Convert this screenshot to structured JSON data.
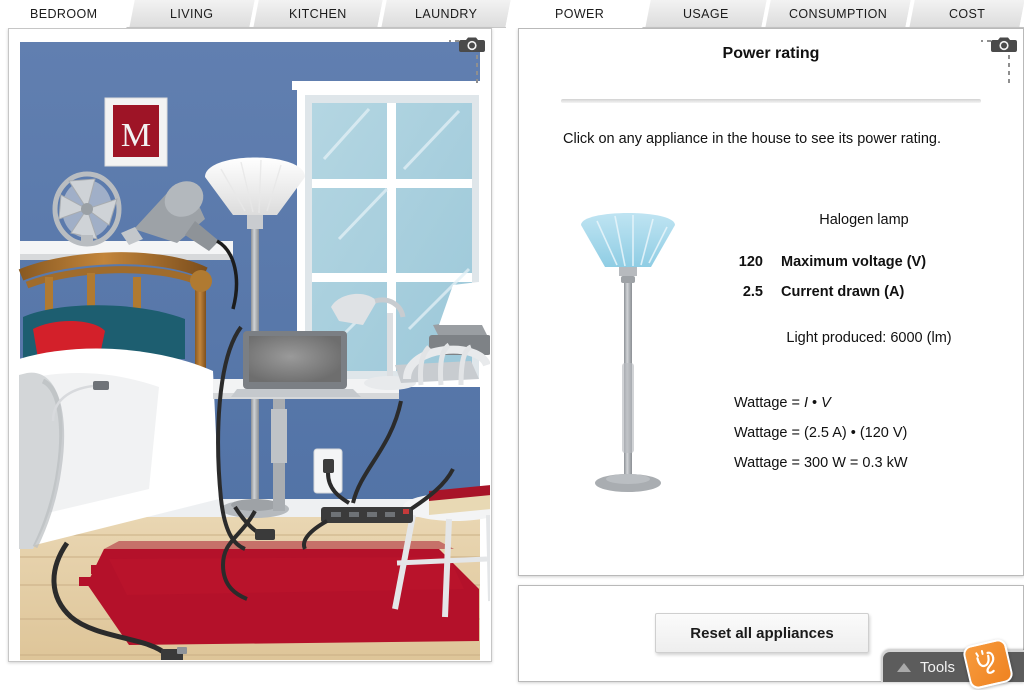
{
  "left_tabs": [
    {
      "label": "BEDROOM",
      "active": true
    },
    {
      "label": "LIVING",
      "active": false
    },
    {
      "label": "KITCHEN",
      "active": false
    },
    {
      "label": "LAUNDRY",
      "active": false
    }
  ],
  "right_tabs": [
    {
      "label": "POWER",
      "active": true
    },
    {
      "label": "USAGE",
      "active": false
    },
    {
      "label": "CONSUMPTION",
      "active": false
    },
    {
      "label": "COST",
      "active": false
    }
  ],
  "info": {
    "title": "Power rating",
    "instruction": "Click on any appliance in the house to see its power rating.",
    "appliance_name": "Halogen lamp",
    "specs": [
      {
        "value": "120",
        "label": "Maximum voltage (V)"
      },
      {
        "value": "2.5",
        "label": "Current drawn (A)"
      }
    ],
    "light_produced": "Light produced: 6000 (lm)",
    "calc": [
      {
        "pre": "Wattage = ",
        "em": "I",
        "post": " • ",
        "em2": "V",
        "post2": ""
      },
      {
        "text": "Wattage = (2.5 A) • (120 V)"
      },
      {
        "text": "Wattage = 300 W = 0.3 kW"
      }
    ],
    "snapshot_icon": "camera-icon"
  },
  "bottom": {
    "reset_label": "Reset all appliances"
  },
  "tools": {
    "label": "Tools",
    "expand_icon": "triangle-up-icon",
    "logo": "explorelearning-logo"
  },
  "scene": {
    "room": "bedroom",
    "wall_color": "#5b7bac",
    "rug_color": "#b4112a",
    "floor_color": "#e3cda6",
    "appliances": [
      "ceiling-style floor lamp",
      "desk lamp",
      "table fan",
      "hair dryer",
      "laptop",
      "printer",
      "power strip"
    ],
    "picture_letter": "M"
  }
}
